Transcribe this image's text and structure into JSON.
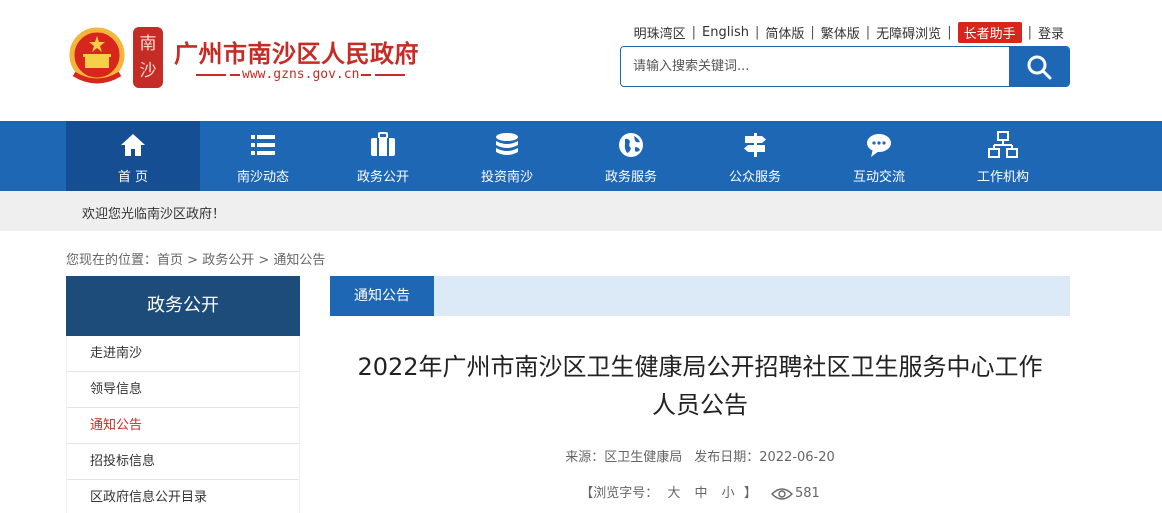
{
  "header": {
    "site_title": "广州市南沙区人民政府",
    "site_url": "www.gzns.gov.cn",
    "seal_text": "南沙",
    "top_links": [
      "明珠湾区",
      "English",
      "简体版",
      "繁体版",
      "无障碍浏览"
    ],
    "elder_helper": "长者助手",
    "login": "登录",
    "search_placeholder": "请输入搜索关键词..."
  },
  "nav": {
    "items": [
      {
        "label": "首 页",
        "icon": "home-icon"
      },
      {
        "label": "南沙动态",
        "icon": "list-icon"
      },
      {
        "label": "政务公开",
        "icon": "briefcase-icon"
      },
      {
        "label": "投资南沙",
        "icon": "coins-icon"
      },
      {
        "label": "政务服务",
        "icon": "globe-icon"
      },
      {
        "label": "公众服务",
        "icon": "signpost-icon"
      },
      {
        "label": "互动交流",
        "icon": "chat-icon"
      },
      {
        "label": "工作机构",
        "icon": "org-chart-icon"
      }
    ]
  },
  "welcome": "欢迎您光临南沙区政府！",
  "breadcrumb": {
    "prefix": "您现在的位置：",
    "items": [
      "首页",
      "政务公开",
      "通知公告"
    ],
    "separator": " > "
  },
  "sidebar": {
    "title": "政务公开",
    "items": [
      "走进南沙",
      "领导信息",
      "通知公告",
      "招投标信息",
      "区政府信息公开目录"
    ]
  },
  "content": {
    "tab": "通知公告",
    "title_line1": "2022年广州市南沙区卫生健康局公开招聘社区卫生服务中心工作",
    "title_line2": "人员公告",
    "source_label": "来源：",
    "source": "区卫生健康局",
    "date_label": "发布日期：",
    "date": "2022-06-20",
    "font_size_open": "【浏览字号：",
    "font_large": "大",
    "font_medium": "中",
    "font_small": "小",
    "font_size_close": "】",
    "views": "581"
  },
  "colors": {
    "brand_red": "#c62c26",
    "nav_blue": "#1d67b5",
    "nav_active": "#164e93",
    "sidebar_head": "#1d4b7a",
    "tabbar_bg": "#dce9f7"
  }
}
